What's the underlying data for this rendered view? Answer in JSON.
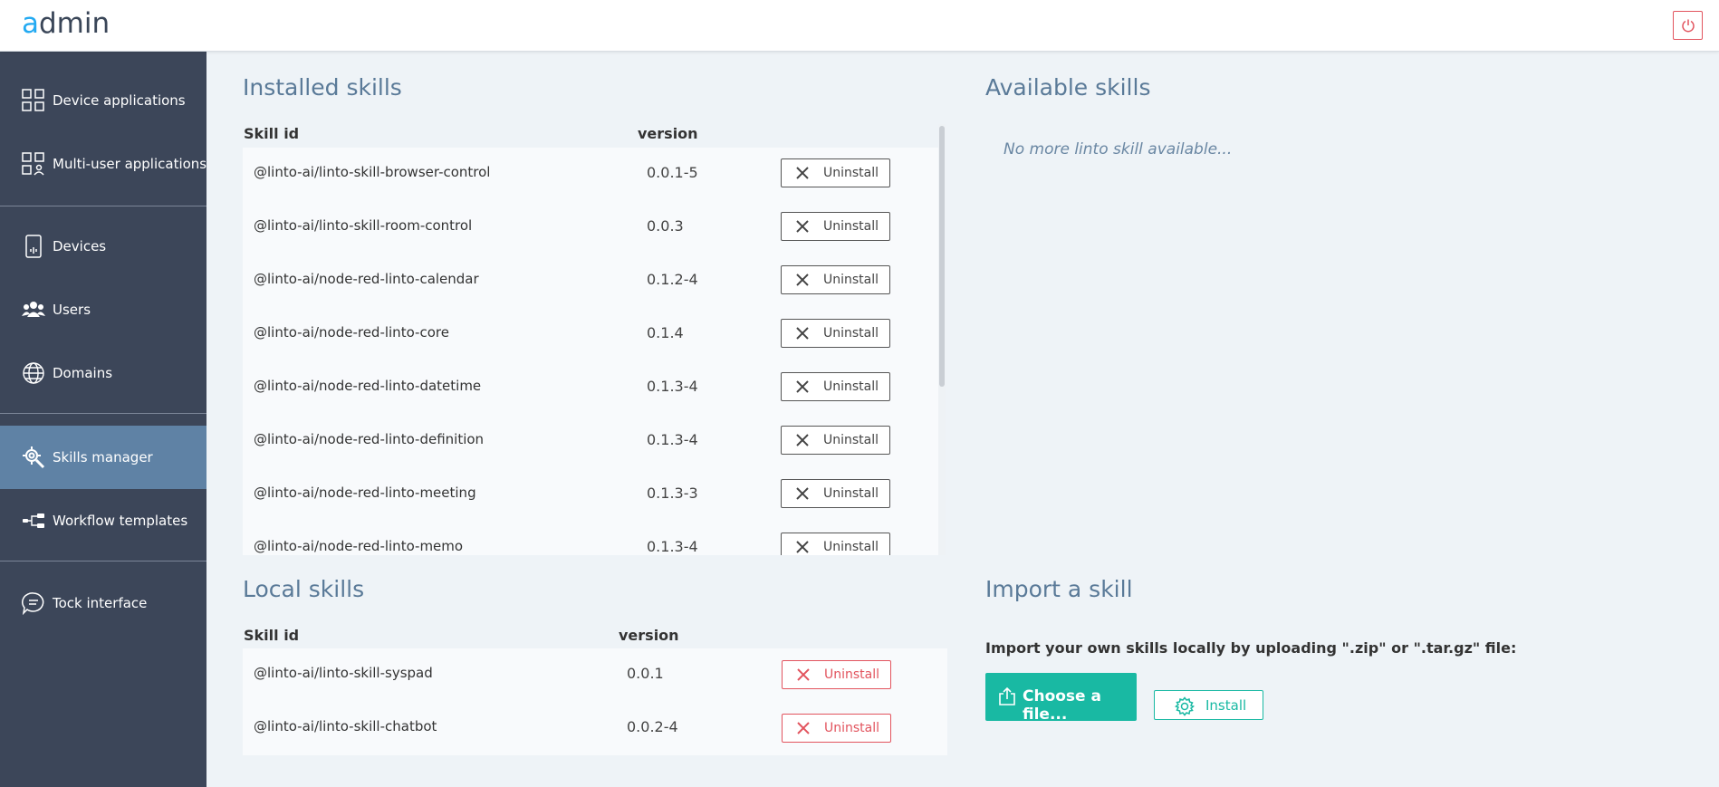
{
  "header": {
    "logo_a": "a",
    "logo_rest": "dmin",
    "power_icon": "power-icon"
  },
  "sidebar": {
    "items": [
      {
        "label": "Device applications",
        "icon": "grid-apps-icon"
      },
      {
        "label": "Multi-user applications",
        "icon": "grid-users-icon"
      },
      {
        "label": "Devices",
        "icon": "tablet-icon"
      },
      {
        "label": "Users",
        "icon": "users-icon"
      },
      {
        "label": "Domains",
        "icon": "globe-icon"
      },
      {
        "label": "Skills manager",
        "icon": "gear-search-icon",
        "active": true
      },
      {
        "label": "Workflow templates",
        "icon": "workflow-icon"
      },
      {
        "label": "Tock interface",
        "icon": "chat-icon"
      }
    ],
    "active_color": "#5f82a5",
    "bg_color": "#3c4659"
  },
  "installed": {
    "title": "Installed skills",
    "col_id": "Skill id",
    "col_version": "version",
    "button_label": "Uninstall",
    "rows": [
      {
        "id": "@linto-ai/linto-skill-browser-control",
        "version": "0.0.1-5"
      },
      {
        "id": "@linto-ai/linto-skill-room-control",
        "version": "0.0.3"
      },
      {
        "id": "@linto-ai/node-red-linto-calendar",
        "version": "0.1.2-4"
      },
      {
        "id": "@linto-ai/node-red-linto-core",
        "version": "0.1.4"
      },
      {
        "id": "@linto-ai/node-red-linto-datetime",
        "version": "0.1.3-4"
      },
      {
        "id": "@linto-ai/node-red-linto-definition",
        "version": "0.1.3-4"
      },
      {
        "id": "@linto-ai/node-red-linto-meeting",
        "version": "0.1.3-3"
      },
      {
        "id": "@linto-ai/node-red-linto-memo",
        "version": "0.1.3-4"
      }
    ]
  },
  "available": {
    "title": "Available skills",
    "empty_message": "No more linto skill available..."
  },
  "local": {
    "title": "Local skills",
    "col_id": "Skill id",
    "col_version": "version",
    "button_label": "Uninstall",
    "rows": [
      {
        "id": "@linto-ai/linto-skill-syspad",
        "version": "0.0.1"
      },
      {
        "id": "@linto-ai/linto-skill-chatbot",
        "version": "0.0.2-4"
      }
    ]
  },
  "import": {
    "title": "Import a skill",
    "description": "Import your own skills locally by uploading \".zip\" or \".tar.gz\" file:",
    "choose_label": "Choose a file...",
    "install_label": "Install",
    "accent_color": "#19b9a3"
  },
  "colors": {
    "danger": "#e2545e",
    "title": "#5a7a98"
  }
}
